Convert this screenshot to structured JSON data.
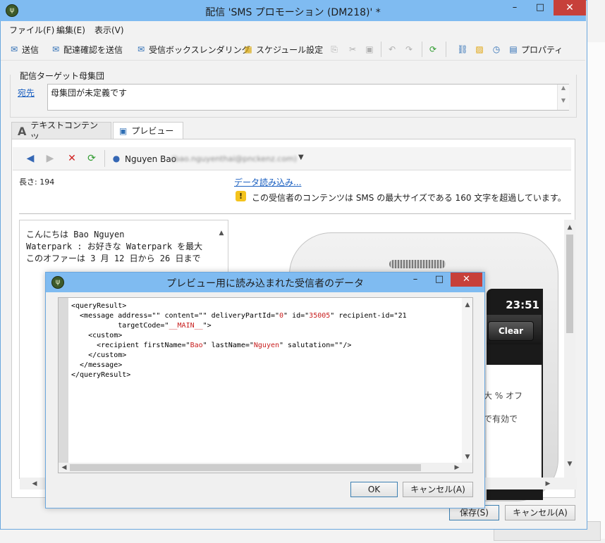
{
  "main_window": {
    "title": "配信 'SMS プロモーション (DM218)' *",
    "controls": {
      "minimize": "–",
      "maximize": "□",
      "close": "✕"
    }
  },
  "menu": [
    "ファイル(F)",
    "編集(E)",
    "表示(V)"
  ],
  "toolbar": {
    "send": "送信",
    "send_proof": "配達確認を送信",
    "inbox_rendering": "受信ボックスレンダリング",
    "schedule": "スケジュール設定",
    "properties": "プロパティ"
  },
  "target": {
    "section_label": "配信ターゲット母集団",
    "to_label": "宛先",
    "to_value": "母集団が未定義です"
  },
  "tabs": {
    "text_content": "テキストコンテンツ",
    "preview": "プレビュー"
  },
  "preview": {
    "recipient_name": "Nguyen Bao",
    "recipient_email": "(bao.nguyenthai@pnckenz.com)",
    "length_label": "長さ: 194",
    "load_data_link": "データ読み込み...",
    "warning": "この受信者のコンテンツは SMS の最大サイズである 160 文字を超過しています。",
    "sms_text": "こんにちは Bao Nguyen\nWaterpark : お好きな Waterpark を最大\nこのオファーは 3 月 12 日から 26 日まで",
    "phone": {
      "time": "23:51",
      "clear_label": "Clear",
      "line1": "大 % オフ",
      "line2": "で有効で"
    }
  },
  "footer": {
    "save": "保存(S)",
    "cancel": "キャンセル(A)"
  },
  "dialog": {
    "title": "プレビュー用に読み込まれた受信者のデータ",
    "controls": {
      "minimize": "–",
      "maximize": "□",
      "close": "✕"
    },
    "xml": {
      "line1": "<queryResult>",
      "line2_pre": "  <message address=\"\" content=\"\" deliveryPartId=\"",
      "line2_v1": "0",
      "line2_mid": "\" id=\"",
      "line2_v2": "35005",
      "line2_post": "\" recipient-id=\"21",
      "line3_pre": "           targetCode=\"",
      "line3_v": "__MAIN__",
      "line3_post": "\">",
      "line4": "    <custom>",
      "line5_pre": "      <recipient firstName=\"",
      "line5_v1": "Bao",
      "line5_mid": "\" lastName=\"",
      "line5_v2": "Nguyen",
      "line5_post": "\" salutation=\"\"/>",
      "line6": "    </custom>",
      "line7": "  </message>",
      "line8": "</queryResult>"
    },
    "ok": "OK",
    "cancel": "キャンセル(A)"
  }
}
